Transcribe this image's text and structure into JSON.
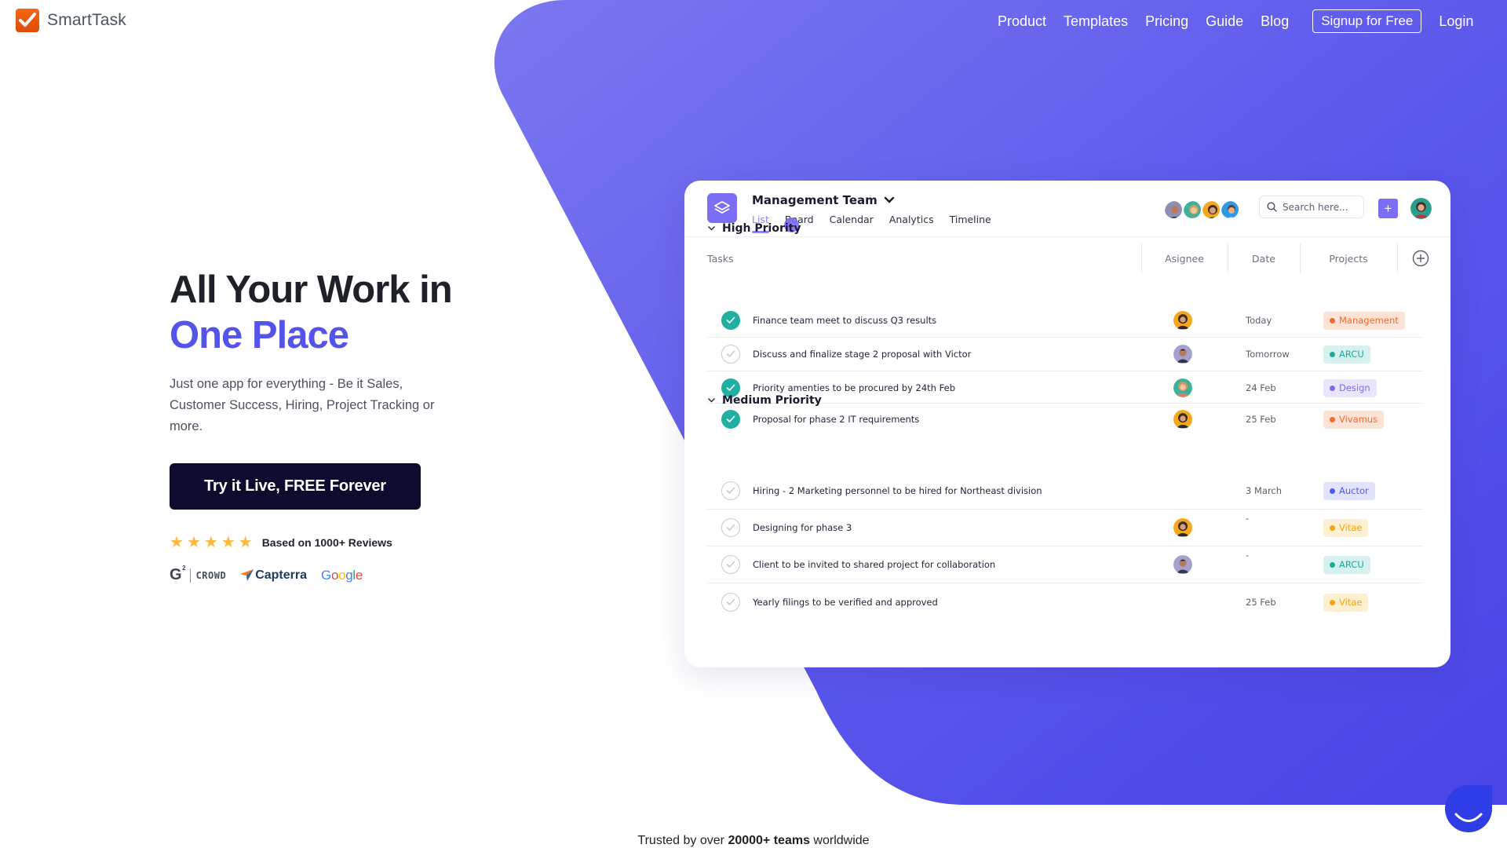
{
  "brand": {
    "name": "SmartTask",
    "logo_icon": "checkmark-icon",
    "logo_color": "#f16410",
    "accent_color": "#5453ea",
    "blob_gradient": [
      "#7b77f0",
      "#4a44e6"
    ]
  },
  "nav": {
    "items": [
      {
        "label": "Product"
      },
      {
        "label": "Templates"
      },
      {
        "label": "Pricing"
      },
      {
        "label": "Guide"
      },
      {
        "label": "Blog"
      }
    ],
    "signup_label": "Signup for Free",
    "login_label": "Login"
  },
  "hero": {
    "title_line1": "All Your Work in",
    "title_line2": "One Place",
    "description": "Just one app for everything - Be it Sales, Customer Success, Hiring, Project Tracking or more.",
    "cta_label": "Try it Live, FREE Forever",
    "rating": {
      "stars": 5,
      "max_stars": 5,
      "text": "Based on 1000+ Reviews"
    },
    "review_logos": [
      {
        "name": "G2 Crowd",
        "label": "CROWD"
      },
      {
        "name": "Capterra",
        "label": "Capterra"
      },
      {
        "name": "Google",
        "label": "Google"
      }
    ]
  },
  "app": {
    "project_title": "Management Team",
    "project_icon": "layers-icon",
    "tabs": [
      {
        "label": "List",
        "active": true
      },
      {
        "label": "Board",
        "active": false
      },
      {
        "label": "Calendar",
        "active": false
      },
      {
        "label": "Analytics",
        "active": false
      },
      {
        "label": "Timeline",
        "active": false
      }
    ],
    "search_placeholder": "Search here...",
    "add_label": "+",
    "columns": {
      "tasks": "Tasks",
      "assignee": "Asignee",
      "date": "Date",
      "projects": "Projects"
    },
    "groups": [
      {
        "title": "High Priority",
        "tasks": [
          {
            "name": "Finance team meet to discuss Q3 results",
            "done": true,
            "assignee": "woman-dark-hair",
            "date": "Today",
            "project": "Management",
            "project_color": "#f26a2c",
            "project_bg": "#fde3d6"
          },
          {
            "name": "Discuss and finalize stage 2 proposal with Victor",
            "done": false,
            "assignee": "man-beard",
            "date": "Tomorrow",
            "project": "ARCU",
            "project_color": "#20a99a",
            "project_bg": "#d7f1ee"
          },
          {
            "name": "Priority amenties to be procured by 24th Feb",
            "done": true,
            "assignee": "woman-red-hair",
            "date": "24 Feb",
            "project": "Design",
            "project_color": "#7a6ef0",
            "project_bg": "#e8e5fd"
          },
          {
            "name": "Proposal for phase 2 IT requirements",
            "done": true,
            "assignee": "woman-dark-hair",
            "date": "25 Feb",
            "project": "Vivamus",
            "project_color": "#f26a2c",
            "project_bg": "#fde3d6"
          }
        ]
      },
      {
        "title": "Medium Priority",
        "tasks": [
          {
            "name": "Hiring - 2 Marketing personnel to be hired for Northeast division",
            "done": false,
            "assignee": "",
            "date": "3 March",
            "project": "Auctor",
            "project_color": "#4b5bef",
            "project_bg": "#e2e4fd"
          },
          {
            "name": "Designing for phase 3",
            "done": false,
            "assignee": "woman-dark-hair",
            "date": "-",
            "project": "Vitae",
            "project_color": "#f5a40e",
            "project_bg": "#fdf0d2"
          },
          {
            "name": "Client to be invited to shared project for collaboration",
            "done": false,
            "assignee": "man-beard",
            "date": "-",
            "project": "ARCU",
            "project_color": "#20a99a",
            "project_bg": "#d7f1ee"
          },
          {
            "name": "Yearly filings to be verified and approved",
            "done": false,
            "assignee": "",
            "date": "25 Feb",
            "project": "Vitae",
            "project_color": "#f5a40e",
            "project_bg": "#fdf0d2"
          }
        ]
      }
    ]
  },
  "footer": {
    "trusted_prefix": "Trusted by over ",
    "trusted_bold": "20000+ teams",
    "trusted_suffix": " worldwide"
  },
  "chat_widget": {
    "icon": "chat-smile-icon",
    "color": "#2e3de6"
  }
}
